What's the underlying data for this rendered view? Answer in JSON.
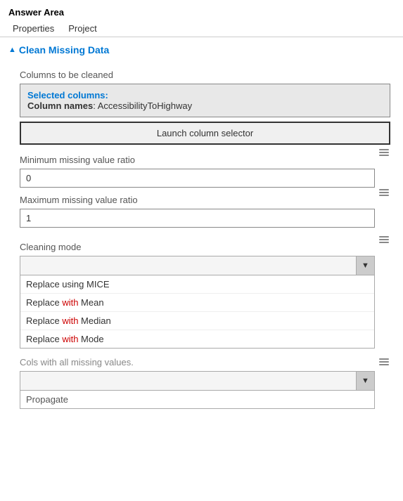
{
  "header": {
    "answer_area_label": "Answer Area",
    "tabs": [
      "Properties",
      "Project"
    ]
  },
  "section": {
    "title": "Clean Missing Data",
    "arrow": "▲"
  },
  "fields": {
    "columns_label": "Columns to be cleaned",
    "selected_columns_title": "Selected columns:",
    "column_names_label": "Column names",
    "column_names_value": "AccessibilityToHighway",
    "launch_btn_label": "Launch column selector",
    "min_ratio_label": "Minimum missing value ratio",
    "min_ratio_value": "0",
    "max_ratio_label": "Maximum missing value ratio",
    "max_ratio_value": "1",
    "cleaning_mode_label": "Cleaning mode",
    "cleaning_mode_options": [
      {
        "text": "Replace using MICE",
        "highlight": ""
      },
      {
        "text": "Replace ",
        "highlight": "with",
        "rest": " Mean"
      },
      {
        "text": "Replace ",
        "highlight": "with",
        "rest": " Median"
      },
      {
        "text": "Replace ",
        "highlight": "with",
        "rest": " Mode"
      }
    ],
    "cols_missing_label": "Cols with all missing values.",
    "cols_missing_value": "",
    "propagate_hint": "Propagate"
  }
}
